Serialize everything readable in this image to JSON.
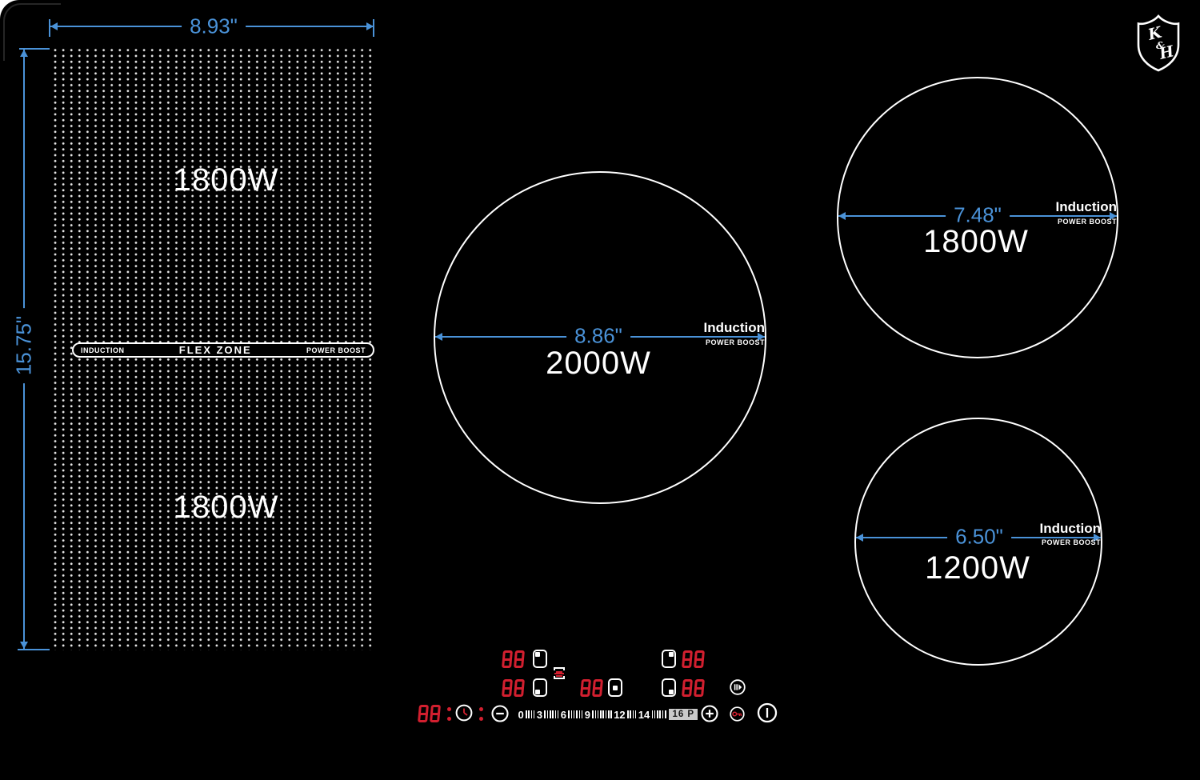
{
  "colors": {
    "dimension_blue": "#4a92d8",
    "segment_red": "#d21f2f",
    "surface_black": "#000000"
  },
  "brand": {
    "shield_text": "K&H"
  },
  "flex_zone": {
    "width_label": "8.93\"",
    "height_label": "15.75\"",
    "top_power": "1800W",
    "bottom_power": "1800W",
    "pill": {
      "left": "INDUCTION",
      "center": "FLEX ZONE",
      "right": "POWER BOOST"
    }
  },
  "burners": [
    {
      "name": "center",
      "diameter": "8.86\"",
      "power": "2000W",
      "type": "Induction",
      "boost": "POWER BOOST"
    },
    {
      "name": "top-right",
      "diameter": "7.48\"",
      "power": "1800W",
      "type": "Induction",
      "boost": "POWER BOOST"
    },
    {
      "name": "bottom-right",
      "diameter": "6.50\"",
      "power": "1200W",
      "type": "Induction",
      "boost": "POWER BOOST"
    }
  ],
  "control_panel": {
    "zone_displays": {
      "flex_top": "88",
      "flex_bottom": "88",
      "center": "88",
      "right_top": "88",
      "right_bottom": "88",
      "timer": "88"
    },
    "power_scale": {
      "segments": [
        {
          "t": "label",
          "v": "0"
        },
        {
          "t": "ticks",
          "n": 4
        },
        {
          "t": "label",
          "v": "3"
        },
        {
          "t": "ticks",
          "n": 6
        },
        {
          "t": "label",
          "v": "6"
        },
        {
          "t": "ticks",
          "n": 6
        },
        {
          "t": "label",
          "v": "9"
        },
        {
          "t": "ticks",
          "n": 8
        },
        {
          "t": "label",
          "v": "12"
        },
        {
          "t": "ticks",
          "n": 4
        },
        {
          "t": "label",
          "v": "14"
        },
        {
          "t": "ticks",
          "n": 6
        },
        {
          "t": "boxed",
          "v": "16 P"
        }
      ]
    }
  }
}
